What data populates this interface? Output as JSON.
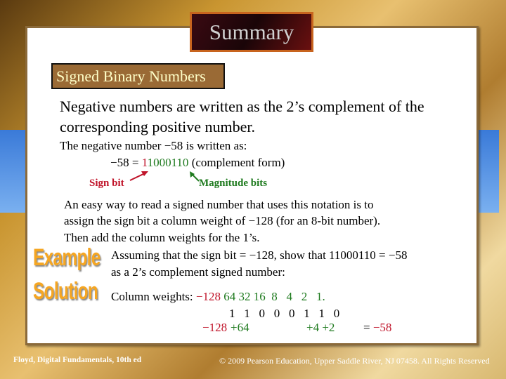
{
  "title": "Summary",
  "section_header": "Signed Binary Numbers",
  "intro": [
    "Negative numbers are written as the 2’s complement of the",
    "corresponding positive number."
  ],
  "example_line": "The negative number −58 is written as:",
  "complement": {
    "lhs": "−58 = ",
    "sign_digit": "1",
    "magnitude_digits": "1000110",
    "suffix": " (complement form)"
  },
  "labels": {
    "sign_bit": "Sign bit",
    "magnitude_bits": "Magnitude bits"
  },
  "explanation": [
    "An easy way to read a signed number that uses this notation is to",
    "assign the sign bit a column weight of −128 (for an 8-bit number).",
    "Then add the column weights for the 1’s."
  ],
  "example": {
    "badge": "Example",
    "lines": [
      "Assuming that the sign bit = −128, show that 11000110 = −58",
      "as a 2’s complement signed number:"
    ]
  },
  "solution": {
    "badge": "Solution",
    "prefix": "Column weights: ",
    "sign_weight": "−128",
    "weights": "64 32 16  8   4   2   1.",
    "bits": "1   1   0   0   0   1   1   0",
    "sum_sign": "−128",
    "sum_pos1": "+64",
    "sum_pos2": "+4 +2",
    "equals": "= ",
    "result": "−58"
  },
  "footer": {
    "left": "Floyd, Digital Fundamentals, 10th ed",
    "right": "© 2009 Pearson Education, Upper Saddle River, NJ 07458. All Rights Reserved"
  },
  "colors": {
    "red": "#c0142a",
    "green": "#1e7a1e",
    "accent": "#9a6a35"
  }
}
